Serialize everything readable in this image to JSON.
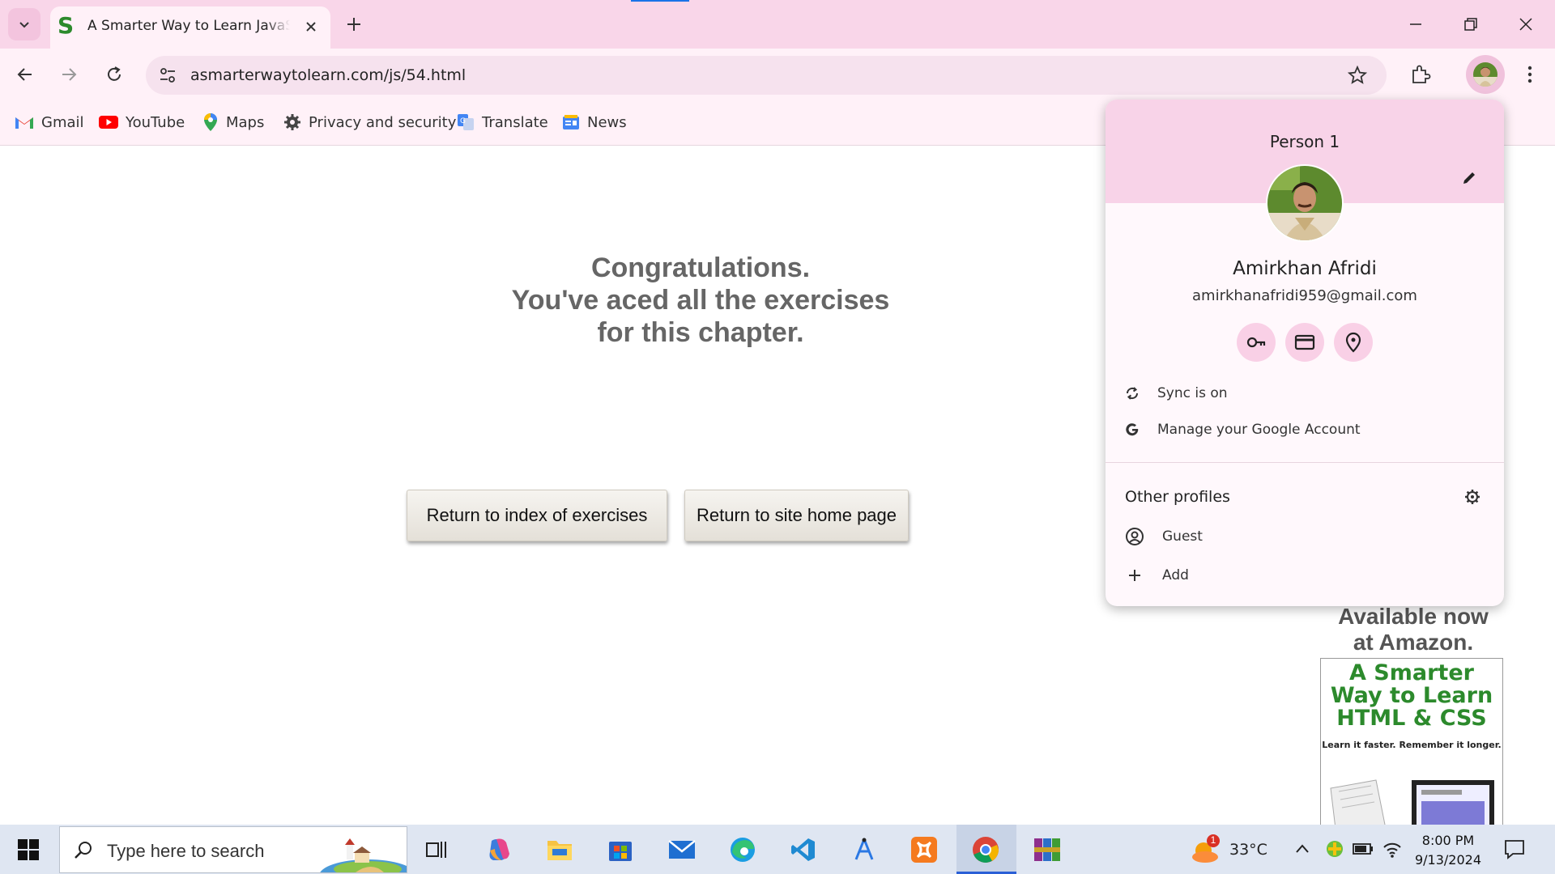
{
  "browser": {
    "tab_title": "A Smarter Way to Learn JavaScript",
    "url": "asmarterwaytolearn.com/js/54.html",
    "bookmarks": [
      "Gmail",
      "YouTube",
      "Maps",
      "Privacy and security",
      "Translate",
      "News"
    ]
  },
  "page": {
    "congrats_line1": "Congratulations.",
    "congrats_line2": "You've aced all the exercises",
    "congrats_line3": "for this chapter.",
    "btn_index": "Return to index of exercises",
    "btn_home": "Return to site home page",
    "amazon_partial": "Available now",
    "amazon_text": "at Amazon.",
    "book_title": "A Smarter Way to Learn HTML & CSS",
    "book_tagline": "Learn it faster. Remember it longer."
  },
  "profile_popup": {
    "person_label": "Person 1",
    "name": "Amirkhan Afridi",
    "email": "amirkhanafridi959@gmail.com",
    "sync_label": "Sync is on",
    "manage_label": "Manage your Google Account",
    "other_profiles_label": "Other profiles",
    "guest_label": "Guest",
    "add_label": "Add"
  },
  "taskbar": {
    "search_placeholder": "Type here to search",
    "weather_temp": "33°C",
    "weather_badge": "1",
    "time": "8:00 PM",
    "date": "9/13/2024"
  },
  "colors": {
    "chrome_pink": "#f9d6e9",
    "toolbar_pink": "#fff1f8",
    "book_green": "#2c8a2c",
    "taskbar": "#dfe6f2"
  }
}
